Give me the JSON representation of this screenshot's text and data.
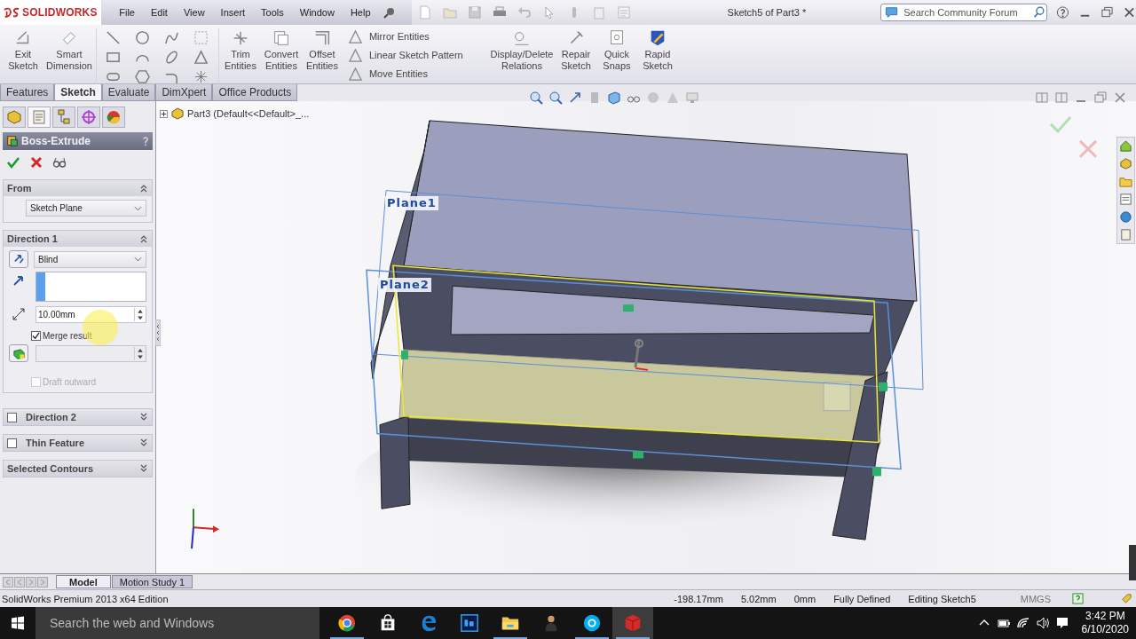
{
  "app": {
    "logo": "SOLIDWORKS",
    "menu": [
      "File",
      "Edit",
      "View",
      "Insert",
      "Tools",
      "Window",
      "Help"
    ],
    "title": "Sketch5 of Part3 *",
    "search": {
      "placeholder": "Search Community Forum"
    }
  },
  "commands": [
    {
      "kind": "large",
      "label": "Exit Sketch"
    },
    {
      "kind": "large",
      "label": "Smart Dimension"
    },
    {
      "kind": "grid"
    },
    {
      "kind": "large",
      "label": "Trim Entities"
    },
    {
      "kind": "large",
      "label": "Convert Entities"
    },
    {
      "kind": "large",
      "label": "Offset Entities"
    },
    {
      "kind": "stack",
      "items": [
        "Mirror Entities",
        "Linear Sketch Pattern",
        "Move Entities"
      ]
    },
    {
      "kind": "large",
      "label": "Display/Delete Relations"
    },
    {
      "kind": "large",
      "label": "Repair Sketch"
    },
    {
      "kind": "large",
      "label": "Quick Snaps"
    },
    {
      "kind": "large",
      "label": "Rapid Sketch"
    }
  ],
  "tabs": [
    {
      "label": "Features",
      "selected": false
    },
    {
      "label": "Sketch",
      "selected": true
    },
    {
      "label": "Evaluate",
      "selected": false
    },
    {
      "label": "DimXpert",
      "selected": false
    },
    {
      "label": "Office Products",
      "selected": false
    }
  ],
  "tree": {
    "label": "Part3  (Default<<Default>_..."
  },
  "property_manager": {
    "title": "Boss-Extrude",
    "from": {
      "title": "From",
      "value": "Sketch Plane"
    },
    "direction1": {
      "title": "Direction 1",
      "end_condition": "Blind",
      "depth": "10.00mm",
      "merge": {
        "label": "Merge result",
        "checked": true
      },
      "draft": {
        "label": "Draft outward",
        "checked": false,
        "disabled": true
      }
    },
    "collapsed": [
      {
        "title": "Direction 2",
        "kind": "check",
        "checked": false
      },
      {
        "title": "Thin Feature",
        "kind": "check",
        "checked": false
      },
      {
        "title": "Selected Contours",
        "kind": "plain"
      }
    ]
  },
  "viewport": {
    "planes": [
      "Plane1",
      "Plane2"
    ]
  },
  "bottom_tabs": [
    {
      "label": "Model",
      "selected": true
    },
    {
      "label": "Motion Study 1",
      "selected": false
    }
  ],
  "status_bar": {
    "edition": "SolidWorks Premium 2013 x64 Edition",
    "fields": [
      "-198.17mm",
      "5.02mm",
      "0mm",
      "Fully Defined",
      "Editing Sketch5"
    ],
    "units": "MMGS"
  },
  "taskbar": {
    "search": {
      "placeholder": "Search the web and Windows"
    },
    "apps": [
      {
        "kind": "chrome",
        "running": true,
        "selected": false
      },
      {
        "kind": "store",
        "running": false,
        "selected": false
      },
      {
        "kind": "edge",
        "running": false,
        "selected": false
      },
      {
        "kind": "photoshop",
        "running": false,
        "selected": false
      },
      {
        "kind": "explorer",
        "running": true,
        "selected": false
      },
      {
        "kind": "figure",
        "running": false,
        "selected": false
      },
      {
        "kind": "skype",
        "running": true,
        "selected": false
      },
      {
        "kind": "solidworks",
        "running": true,
        "selected": true
      }
    ],
    "time": "3:42 PM",
    "date": "6/10/2020"
  }
}
